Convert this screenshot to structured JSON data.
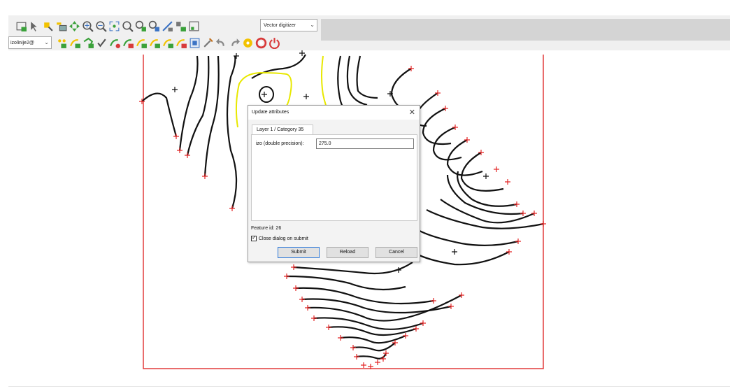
{
  "toolbar": {
    "module_select": "Vector digitizer",
    "layer_select": "izolinije2@",
    "row1_icons": [
      "display-icon",
      "select-arrow-icon",
      "query-icon",
      "layer-list-icon",
      "pan-icon",
      "zoom-in-icon",
      "zoom-out-icon",
      "zoom-extent-icon",
      "zoom-region-icon",
      "zoom-layer-icon",
      "zoom-back-icon",
      "measure-icon",
      "attribute-table-icon",
      "legend-icon"
    ],
    "row2_icons": [
      "new-point-icon",
      "new-line-icon",
      "new-boundary-icon",
      "new-centroid-icon",
      "move-vertex-icon",
      "add-vertex-icon",
      "remove-vertex-icon",
      "edit-line-icon",
      "move-feature-icon",
      "delete-feature-icon",
      "edit-attributes-icon",
      "tools-icon",
      "undo-icon",
      "redo-icon",
      "settings-icon",
      "help-icon",
      "quit-icon"
    ],
    "colors": {
      "toolbar_bg": "#f0f0f0",
      "icon_yellow": "#f2c200",
      "icon_green": "#3aa13a",
      "icon_red": "#d83a3a",
      "icon_blue": "#3b73c4"
    }
  },
  "map": {
    "colors": {
      "boundary": "#e23b3b",
      "contour": "#111111",
      "highlight_contour": "#e8e800",
      "vertex_marker": "#e32626",
      "centroid_marker": "#111111"
    }
  },
  "dialog": {
    "title": "Update attributes",
    "tab_label": "Layer 1 / Category 35",
    "field_label": "izo (double precision):",
    "field_value": "275.0",
    "feature_id_label": "Feature id:",
    "feature_id_value": "26",
    "checkbox_label": "Close dialog on submit",
    "checkbox_checked": true,
    "buttons": {
      "submit": "Submit",
      "reload": "Reload",
      "cancel": "Cancel"
    }
  }
}
